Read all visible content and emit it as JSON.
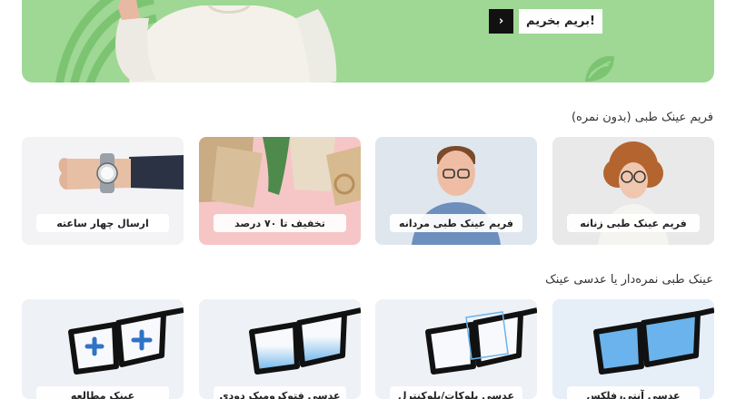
{
  "banner": {
    "cta_label": "بریم بخریم!",
    "cta_arrow": "›"
  },
  "sections": [
    {
      "title": "فریم عینک طبی (بدون نمره)",
      "cards": [
        {
          "label": "فریم عینک طبی زنانه"
        },
        {
          "label": "فریم عینک طبی مردانه"
        },
        {
          "label": "تخفیف تا ۷۰ درصد"
        },
        {
          "label": "ارسال چهار ساعته"
        }
      ]
    },
    {
      "title": "عینک طبی نمره‌دار یا عدسی عینک",
      "cards": [
        {
          "label": "عدسی آنتی‌رفلکس"
        },
        {
          "label": "عدسی بلوکات/بلوکنترل"
        },
        {
          "label": "عدسی فتوکرومیک دودی"
        },
        {
          "label": "عینک مطالعه"
        }
      ]
    }
  ],
  "colors": {
    "banner_bg": "#9ed894",
    "cta_bg": "#111111",
    "lens_blue": "#6ab3ec"
  }
}
